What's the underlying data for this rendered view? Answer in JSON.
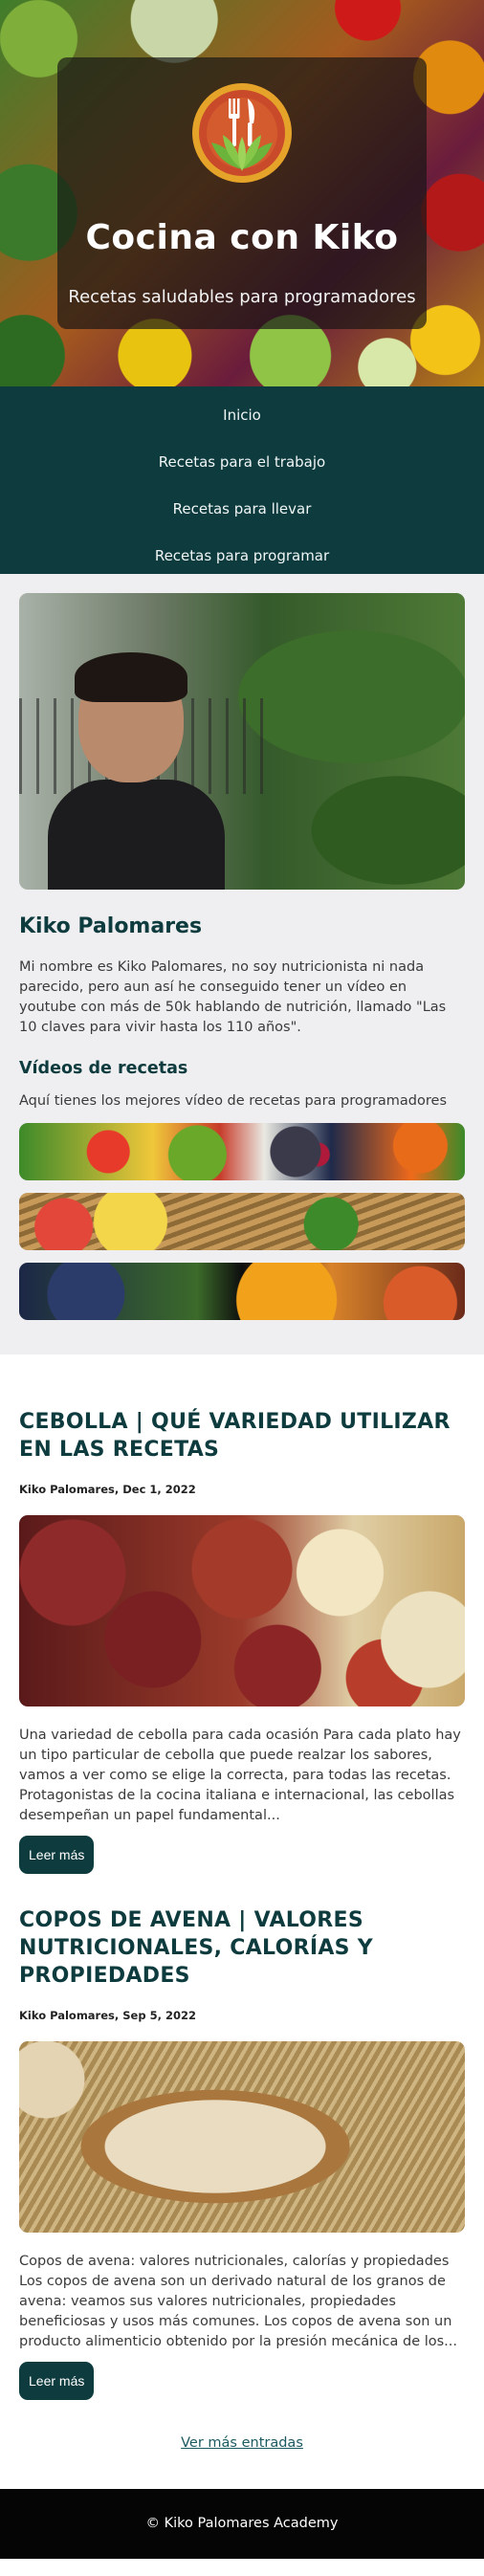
{
  "hero": {
    "title": "Cocina con Kiko",
    "subtitle": "Recetas saludables para programadores",
    "logo_icon": "fork-knife-leaf-logo"
  },
  "nav": {
    "items": [
      {
        "label": "Inicio"
      },
      {
        "label": "Recetas para el trabajo"
      },
      {
        "label": "Recetas para llevar"
      },
      {
        "label": "Recetas para programar"
      }
    ]
  },
  "about": {
    "name": "Kiko Palomares",
    "bio": "Mi nombre es Kiko Palomares, no soy nutricionista ni nada parecido, pero aun así he conseguido tener un vídeo en youtube con más de 50k hablando de nutrición, llamado \"Las 10 claves para vivir hasta los 110 años\".",
    "videos_title": "Vídeos de recetas",
    "videos_text": "Aquí tienes los mejores vídeo de recetas para programadores"
  },
  "posts": [
    {
      "title": "CEBOLLA | QUÉ VARIEDAD UTILIZAR EN LAS RECETAS",
      "meta": "Kiko Palomares, Dec 1, 2022",
      "excerpt": "Una variedad de cebolla para cada ocasión Para cada plato hay un tipo particular de cebolla que puede realzar los sabores, vamos a ver como se elige la correcta, para todas las recetas. Protagonistas de la cocina italiana e internacional, las cebollas desempeñan un papel fundamental...",
      "button": "Leer más"
    },
    {
      "title": "COPOS DE AVENA | VALORES NUTRICIONALES, CALORÍAS Y PROPIEDADES",
      "meta": "Kiko Palomares, Sep 5, 2022",
      "excerpt": "Copos de avena: valores nutricionales, calorías y propiedades Los copos de avena son un derivado natural de los granos de avena: veamos sus valores nutricionales, propiedades beneficiosas y usos más comunes. Los copos de avena son un producto alimenticio obtenido por la presión mecánica de los...",
      "button": "Leer más"
    }
  ],
  "more_link": "Ver más entradas",
  "footer": "© Kiko Palomares Academy",
  "colors": {
    "primary": "#0d3b3e",
    "about_bg": "#efeff1",
    "footer_bg": "#050505"
  }
}
